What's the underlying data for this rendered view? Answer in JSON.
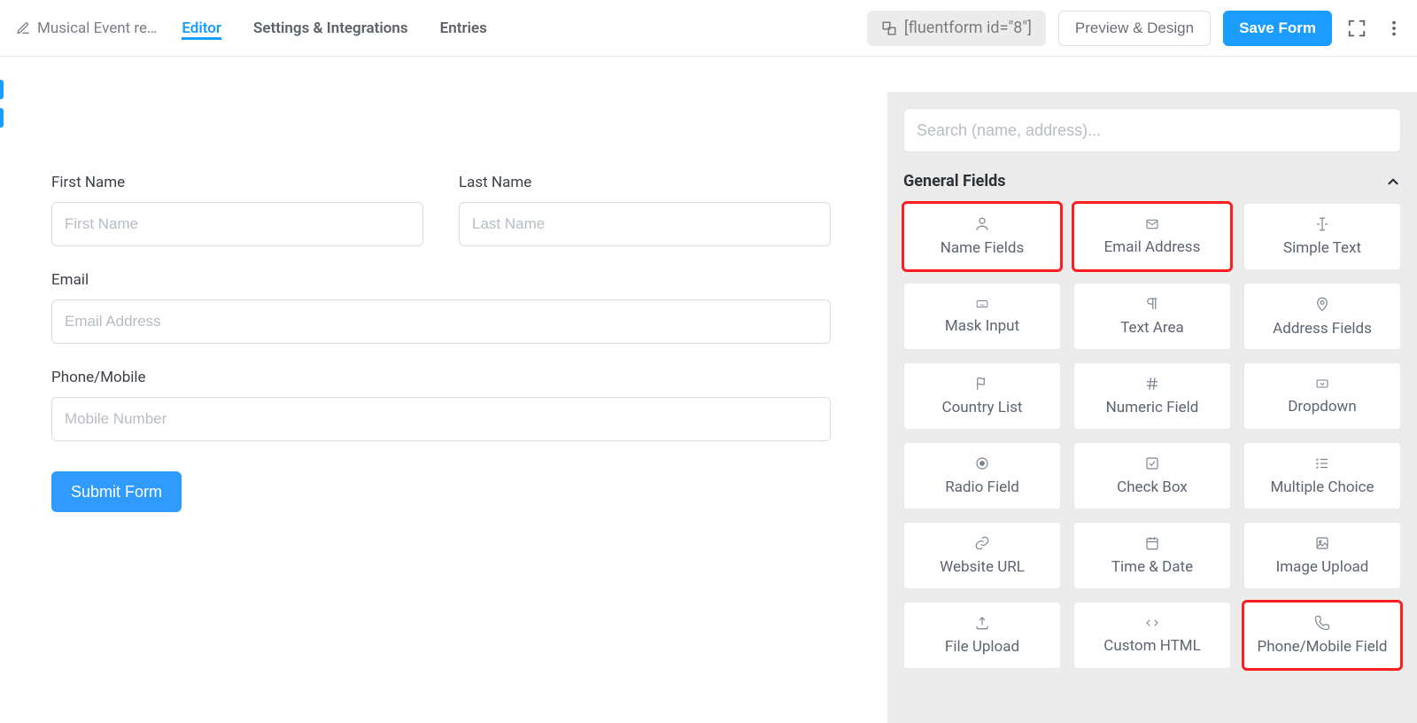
{
  "header": {
    "form_title": "Musical Event re…",
    "tabs": {
      "editor": "Editor",
      "settings": "Settings & Integrations",
      "entries": "Entries"
    },
    "shortcode": "[fluentform id=\"8\"]",
    "preview_btn": "Preview & Design",
    "save_btn": "Save Form"
  },
  "form": {
    "first_name_label": "First Name",
    "first_name_ph": "First Name",
    "last_name_label": "Last Name",
    "last_name_ph": "Last Name",
    "email_label": "Email",
    "email_ph": "Email Address",
    "phone_label": "Phone/Mobile",
    "phone_ph": "Mobile Number",
    "submit_label": "Submit Form"
  },
  "sidebar": {
    "search_ph": "Search (name, address)...",
    "group_title": "General Fields",
    "tiles": {
      "name": "Name Fields",
      "email": "Email Address",
      "text": "Simple Text",
      "mask": "Mask Input",
      "textarea": "Text Area",
      "address": "Address Fields",
      "country": "Country List",
      "numeric": "Numeric Field",
      "dropdown": "Dropdown",
      "radio": "Radio Field",
      "checkbox": "Check Box",
      "multi": "Multiple Choice",
      "url": "Website URL",
      "datetime": "Time & Date",
      "image": "Image Upload",
      "file": "File Upload",
      "html": "Custom HTML",
      "phone": "Phone/Mobile Field"
    }
  }
}
